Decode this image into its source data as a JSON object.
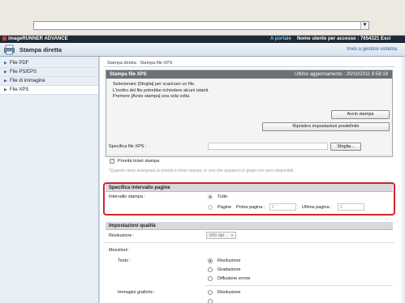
{
  "app": {
    "brand": "imageRUNNER ADVANCE",
    "portal": "A portale",
    "user": "Nome utente per accesso : 7654321 Esci",
    "title": "Stampa diretta",
    "title_link": "Invio a gestore sistema"
  },
  "sidebar": {
    "items": [
      {
        "label": "File PDF"
      },
      {
        "label": "File PS/EPS"
      },
      {
        "label": "File di immagine"
      },
      {
        "label": "File XPS"
      }
    ]
  },
  "breadcrumb": "Stampa diretta : Stampa file XPS",
  "panel": {
    "title": "Stampa file XPS",
    "updated": "Ultimo aggiornamento : 20/10/2011 6:58:19",
    "msg1": "Selezionare [Sfoglia] per scaricare un file.",
    "msg2": "L'inoltro del file potrebbe richiedere alcuni istanti.",
    "msg3": "Premere [Avvio stampa] una sola volta.",
    "btn_print": "Avvio stampa",
    "btn_reset": "Ripristino impostazioni predefinite"
  },
  "file": {
    "label": "Specifica file XPS :",
    "browse": "Sfoglia..."
  },
  "priority": {
    "label": "Priorità ticket stampa",
    "note": "*Quando viene assegnata la priorità a ticket stampa, le voci che appaiono in grigio non sono disponibili."
  },
  "range": {
    "title": "Specifica intervallo pagine",
    "label": "Intervallo stampa :",
    "all": "Tutte",
    "pages": "Pagine",
    "first": "Prima pagina :",
    "first_value": "1",
    "last": "Ultima pagina :",
    "last_value": "1"
  },
  "quality": {
    "title": "Impostazioni qualità",
    "resolution_label": "Risoluzione :",
    "resolution_value": "600 dpi",
    "halftone_label": "Mezzitoni :",
    "text_label": "Testo :",
    "text_opt1": "Risoluzione",
    "text_opt2": "Gradazione",
    "text_opt3": "Diffusione errore",
    "graphics_label": "Immagini grafiche :",
    "graphics_opt1": "Risoluzione"
  },
  "icons": {
    "title": "print-icon",
    "dropdown": "chevron-down-icon"
  },
  "colors": {
    "brand_bar": "#1f2a36",
    "panel_head": "#6b7177",
    "highlight_frame": "#d1232a",
    "link": "#1d5fa8"
  }
}
